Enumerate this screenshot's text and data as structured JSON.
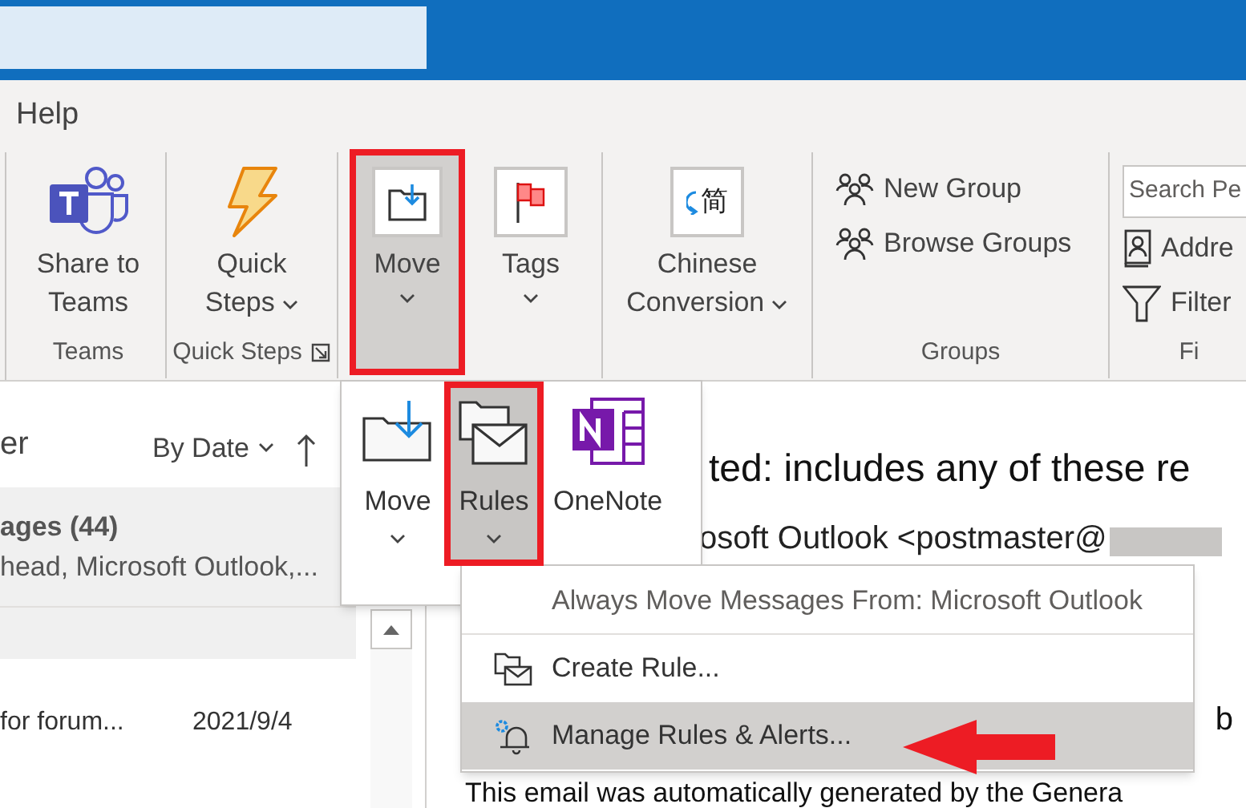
{
  "ribbon": {
    "tabs": [
      {
        "label": "Help",
        "selected": false
      }
    ],
    "groups": [
      {
        "label": "Teams",
        "launcher": false,
        "items": [
          {
            "kind": "large",
            "lines": [
              "Share to",
              "Teams"
            ],
            "dropdown": false,
            "pressed": false,
            "highlighted": false
          }
        ]
      },
      {
        "label": "Quick Steps",
        "launcher": true,
        "items": [
          {
            "kind": "large",
            "lines": [
              "Quick",
              "Steps"
            ],
            "dropdown": true,
            "pressed": false,
            "highlighted": false
          }
        ]
      },
      {
        "items": [
          {
            "kind": "large",
            "lines": [
              "Move"
            ],
            "dropdown": true,
            "pressed": true,
            "highlighted": true
          },
          {
            "kind": "large",
            "lines": [
              "Tags"
            ],
            "dropdown": true,
            "pressed": false,
            "highlighted": false
          }
        ]
      },
      {
        "items": [
          {
            "kind": "large",
            "glyph": "简",
            "lines": [
              "Chinese",
              "Conversion"
            ],
            "dropdown": true,
            "pressed": false,
            "highlighted": false
          }
        ]
      },
      {
        "label": "Groups",
        "launcher": false,
        "items": [
          {
            "kind": "small",
            "label": "New Group"
          },
          {
            "kind": "small",
            "label": "Browse Groups"
          }
        ]
      },
      {
        "label": "Fi",
        "launcher": false,
        "items": [
          {
            "kind": "search",
            "placeholder": "Search Pe"
          },
          {
            "kind": "small",
            "label": "Addre"
          },
          {
            "kind": "small",
            "label": "Filter"
          }
        ]
      }
    ]
  },
  "move_dropdown": {
    "items": [
      {
        "label": "Move",
        "dropdown": true,
        "pressed": false,
        "highlighted": false
      },
      {
        "label": "Rules",
        "dropdown": true,
        "pressed": true,
        "highlighted": true
      },
      {
        "label": "OneNote",
        "dropdown": false,
        "pressed": false,
        "highlighted": false
      }
    ]
  },
  "rules_menu": {
    "header": "Always Move Messages From: Microsoft Outlook",
    "items": [
      {
        "label": "Create Rule...",
        "selected": false
      },
      {
        "label": "Manage Rules & Alerts...",
        "selected": true
      }
    ]
  },
  "mail_list": {
    "column_1": "er",
    "sort": "By Date",
    "group": {
      "title": "ages (44)",
      "senders": "head, Microsoft Outlook,..."
    },
    "rows": [
      {
        "subject": "for forum...",
        "date": "2021/9/4"
      }
    ]
  },
  "reading_pane": {
    "heading": "ted: includes any of these re",
    "from": "osoft Outlook <postmaster@",
    "line_2": "b",
    "body": "This email was automatically generated by the Genera"
  }
}
